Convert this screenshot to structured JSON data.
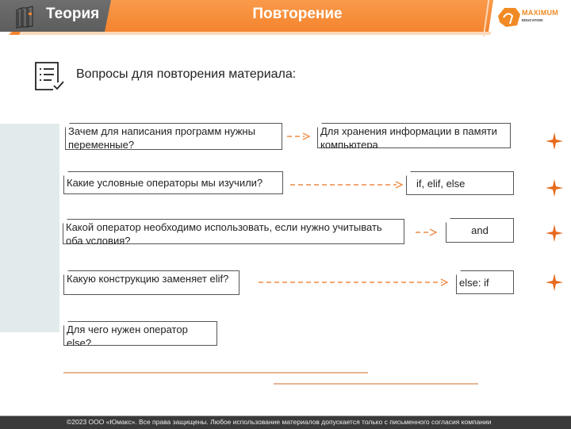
{
  "header": {
    "section_label": "Теория",
    "title": "Повторение",
    "logo": {
      "main": "MAXIMUM",
      "sub": "EDUCATION"
    }
  },
  "icons": {
    "book": "book-icon",
    "checklist": "checklist-icon",
    "star": "star-icon",
    "arrow": "dashed-arrow-icon"
  },
  "colors": {
    "accent": "#f5842e",
    "header_gray": "#636363",
    "panel": "#e2ebec",
    "footer": "#3a3a3a"
  },
  "section": {
    "title": "Вопросы для повторения материала:"
  },
  "qa": [
    {
      "question": "  Зачем для написания программ нужны переменные?",
      "answer": " Для хранения информации в памяти компьютера"
    },
    {
      "question": "Какие условные операторы мы изучили?",
      "answer": "if, elif, else"
    },
    {
      "question": "  Какой оператор необходимо использовать, если нужно учитывать оба условия?",
      "answer": "and"
    },
    {
      "question": "Какую конструкцию заменяет elif?",
      "answer": "else: if"
    },
    {
      "question": "Для чего нужен оператор else?",
      "answer": ""
    }
  ],
  "footer": {
    "text": "©2023 ООО «Юмакс». Все права защищены. Любое использование материалов допускается только с  письменного согласия компании"
  }
}
